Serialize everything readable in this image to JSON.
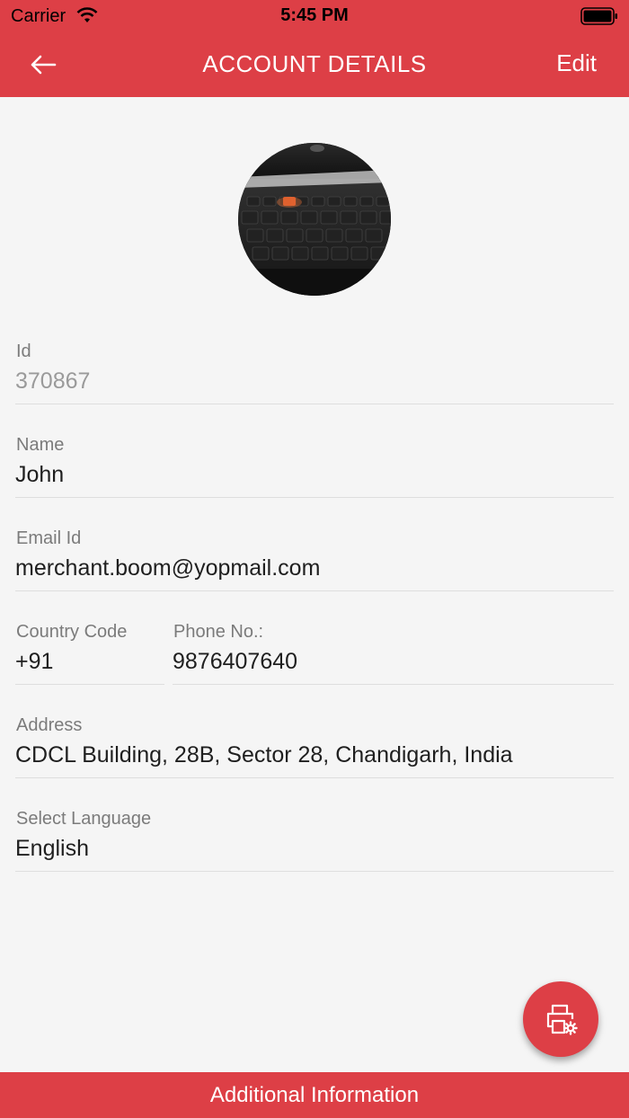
{
  "status_bar": {
    "carrier": "Carrier",
    "time": "5:45 PM",
    "icons": [
      "wifi-icon",
      "battery-icon"
    ]
  },
  "header": {
    "back_icon": "arrow-left-icon",
    "title": "ACCOUNT DETAILS",
    "edit_label": "Edit"
  },
  "profile": {
    "avatar_image": "keyboard-photo"
  },
  "fields": {
    "id": {
      "label": "Id",
      "value": "370867"
    },
    "name": {
      "label": "Name",
      "value": "John"
    },
    "email": {
      "label": "Email Id",
      "value": "merchant.boom@yopmail.com"
    },
    "country_code": {
      "label": "Country Code",
      "value": "+91"
    },
    "phone": {
      "label": "Phone No.:",
      "value": "9876407640"
    },
    "address": {
      "label": "Address",
      "value": "CDCL Building, 28B, Sector 28, Chandigarh, India"
    },
    "language": {
      "label": "Select Language",
      "value": "English"
    }
  },
  "fab": {
    "icon": "printer-settings-icon"
  },
  "bottom_bar": {
    "label": "Additional Information"
  },
  "colors": {
    "accent": "#dd3f46",
    "background": "#f5f5f5",
    "label": "#7b7b7b",
    "value": "#1f1f1f"
  }
}
